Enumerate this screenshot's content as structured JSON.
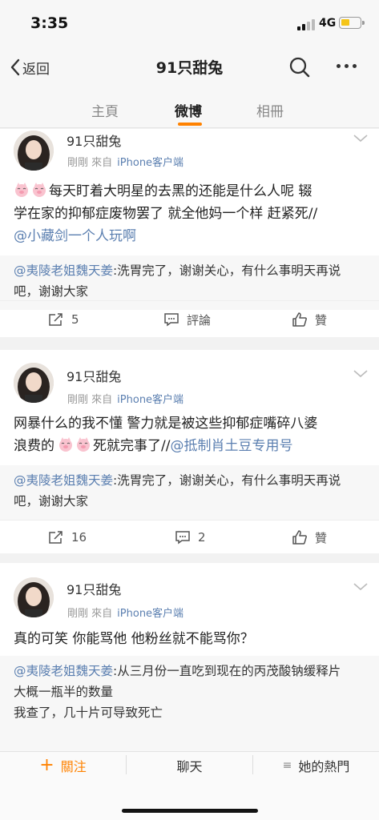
{
  "status_bar": {
    "time": "3:35",
    "network": "4G"
  },
  "nav": {
    "back_label": "返回",
    "title": "91只甜兔"
  },
  "tabs": [
    {
      "label": "主頁",
      "active": false
    },
    {
      "label": "微博",
      "active": true
    },
    {
      "label": "相冊",
      "active": false
    }
  ],
  "accent_color": "#ff8200",
  "link_color": "#5b7fb0",
  "posts": [
    {
      "author": "91只甜兔",
      "time": "剛剛",
      "source_prefix": "來自",
      "source": "iPhone客户端",
      "text_line1": "每天盯着大明星的去黑的还能是什么人呢 辍",
      "text_line2": "学在家的抑郁症废物罢了 就全他妈一个样 赶紧死//",
      "text_mention": "@小藏剑一个人玩啊",
      "quote_mention": "@夷陵老姐魏天姜",
      "quote_text": ":洗胃完了，谢谢关心，有什么事明天再说吧，谢谢大家",
      "reposts": "5",
      "comments_label": "評論",
      "likes_label": "贊"
    },
    {
      "author": "91只甜兔",
      "time": "剛剛",
      "source_prefix": "來自",
      "source": "iPhone客户端",
      "text_line1": "网暴什么的我不懂 警力就是被这些抑郁症嘴碎八婆",
      "text_line2_prefix": "浪费的",
      "text_line2_suffix": "死就完事了//",
      "text_mention": "@抵制肖土豆专用号",
      "quote_mention": "@夷陵老姐魏天姜",
      "quote_text": ":洗胃完了，谢谢关心，有什么事明天再说吧，谢谢大家",
      "reposts": "16",
      "comments": "2",
      "likes_label": "贊"
    },
    {
      "author": "91只甜兔",
      "time": "剛剛",
      "source_prefix": "來自",
      "source": "iPhone客户端",
      "text": "真的可笑 你能骂他 他粉丝就不能骂你？",
      "quote_mention": "@夷陵老姐魏天姜",
      "quote_text": ":从三月份一直吃到现在的丙茂酸钠缓释片",
      "quote_line2": "大概一瓶半的数量",
      "quote_line3": "我查了，几十片可导致死亡"
    }
  ],
  "bottom_bar": {
    "follow_label": "關注",
    "chat_label": "聊天",
    "hot_label": "她的熱門"
  }
}
